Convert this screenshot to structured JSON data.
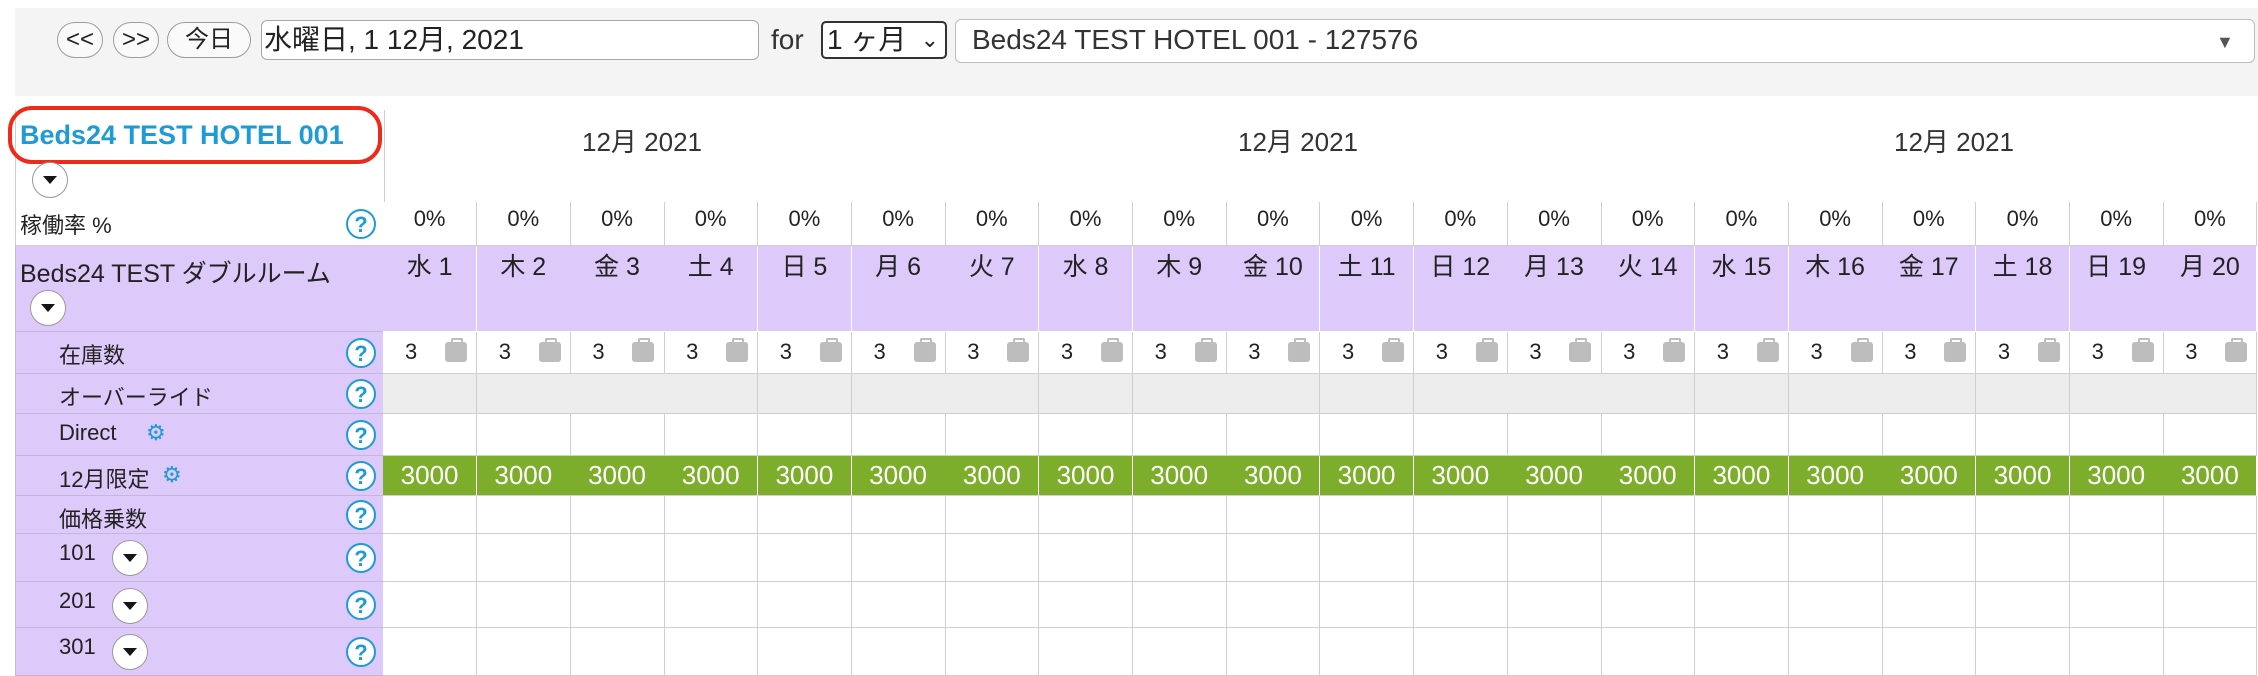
{
  "toolbar": {
    "prev_label": "<<",
    "next_label": ">>",
    "today_label": "今日",
    "date_value": "水曜日, 1 12月, 2021",
    "for_label": "for",
    "period_value": "1 ヶ月",
    "property_value": "Beds24 TEST HOTEL 001 - 127576"
  },
  "header": {
    "hotel_name": "Beds24 TEST HOTEL 001",
    "months": [
      "12月 2021",
      "12月 2021",
      "12月 2021"
    ]
  },
  "occupancy": {
    "label": "稼働率 %",
    "values": [
      "0%",
      "0%",
      "0%",
      "0%",
      "0%",
      "0%",
      "0%",
      "0%",
      "0%",
      "0%",
      "0%",
      "0%",
      "0%",
      "0%",
      "0%",
      "0%",
      "0%",
      "0%",
      "0%",
      "0%"
    ]
  },
  "room": {
    "name": "Beds24 TEST ダブルルーム",
    "days": [
      "水 1",
      "木 2",
      "金 3",
      "土 4",
      "日 5",
      "月 6",
      "火 7",
      "水 8",
      "木 9",
      "金 10",
      "土 11",
      "日 12",
      "月 13",
      "火 14",
      "水 15",
      "木 16",
      "金 17",
      "土 18",
      "日 19",
      "月 20"
    ]
  },
  "rows": {
    "inventory_label": "在庫数",
    "inventory_values": [
      "3",
      "3",
      "3",
      "3",
      "3",
      "3",
      "3",
      "3",
      "3",
      "3",
      "3",
      "3",
      "3",
      "3",
      "3",
      "3",
      "3",
      "3",
      "3",
      "3"
    ],
    "override_label": "オーバーライド",
    "direct_label": "Direct",
    "special_label": "12月限定",
    "special_prices": [
      "3000",
      "3000",
      "3000",
      "3000",
      "3000",
      "3000",
      "3000",
      "3000",
      "3000",
      "3000",
      "3000",
      "3000",
      "3000",
      "3000",
      "3000",
      "3000",
      "3000",
      "3000",
      "3000",
      "3000"
    ],
    "multiplier_label": "価格乗数",
    "units": [
      "101",
      "201",
      "301"
    ]
  },
  "icons": {
    "help": "?",
    "gear": "⚙"
  },
  "colors": {
    "accent_blue": "#1d9bd6",
    "room_bg": "#ddc9fa",
    "price_green": "#7cae2b",
    "highlight_red": "#ee2b1b"
  }
}
